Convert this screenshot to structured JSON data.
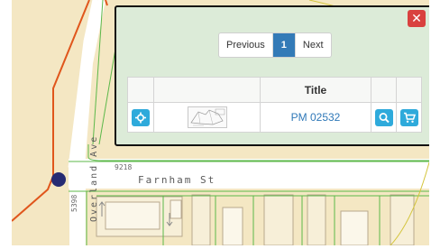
{
  "map": {
    "street_horizontal": "Farnham St",
    "street_vertical": "Overland Ave",
    "lot_number_a": "9218",
    "lot_number_b": "5398",
    "colors": {
      "parcel_fill": "#f4e7c3",
      "road_fill": "#ffffff",
      "highlight_road": "#e0561c",
      "parcel_line": "#5cb84a",
      "marker": "#262b73"
    }
  },
  "popup": {
    "close_icon": "close-icon",
    "pagination": {
      "previous_label": "Previous",
      "current_page": "1",
      "next_label": "Next"
    },
    "table": {
      "header_title": "Title",
      "rows": [
        {
          "zoom_icon": "crosshair-icon",
          "thumbnail_icon": "map-thumbnail",
          "title": "PM 02532",
          "search_icon": "search-icon",
          "cart_icon": "cart-icon"
        }
      ]
    }
  }
}
